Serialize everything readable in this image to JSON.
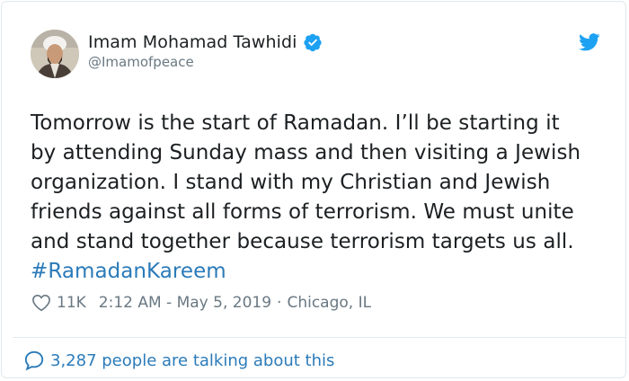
{
  "tweet": {
    "author": {
      "display_name": "Imam Mohamad Tawhidi",
      "handle": "@Imamofpeace",
      "verified": true,
      "avatar_icon": "avatar"
    },
    "text_lines": [
      "Tomorrow is the start of Ramadan. I’ll be starting it",
      "by attending Sunday mass and then visiting a Jewish",
      "organization. I stand with my Christian and Jewish",
      "friends against all forms of terrorism. We must unite",
      "and stand together because terrorism targets us all."
    ],
    "hashtag": "#RamadanKareem",
    "likes": "11K",
    "timestamp": "2:12 AM - May 5, 2019",
    "separator": "·",
    "location": "Chicago, IL",
    "talking_about": "3,287 people are talking about this"
  },
  "icons": {
    "verified": "verified-badge-icon",
    "twitter": "twitter-bird-icon",
    "like": "heart-icon",
    "reply": "speech-bubble-icon"
  },
  "colors": {
    "twitter_blue": "#1da1f2",
    "link_blue": "#2b7bb9",
    "text": "#1c2022",
    "muted": "#697882",
    "border": "#e1e8ed"
  }
}
